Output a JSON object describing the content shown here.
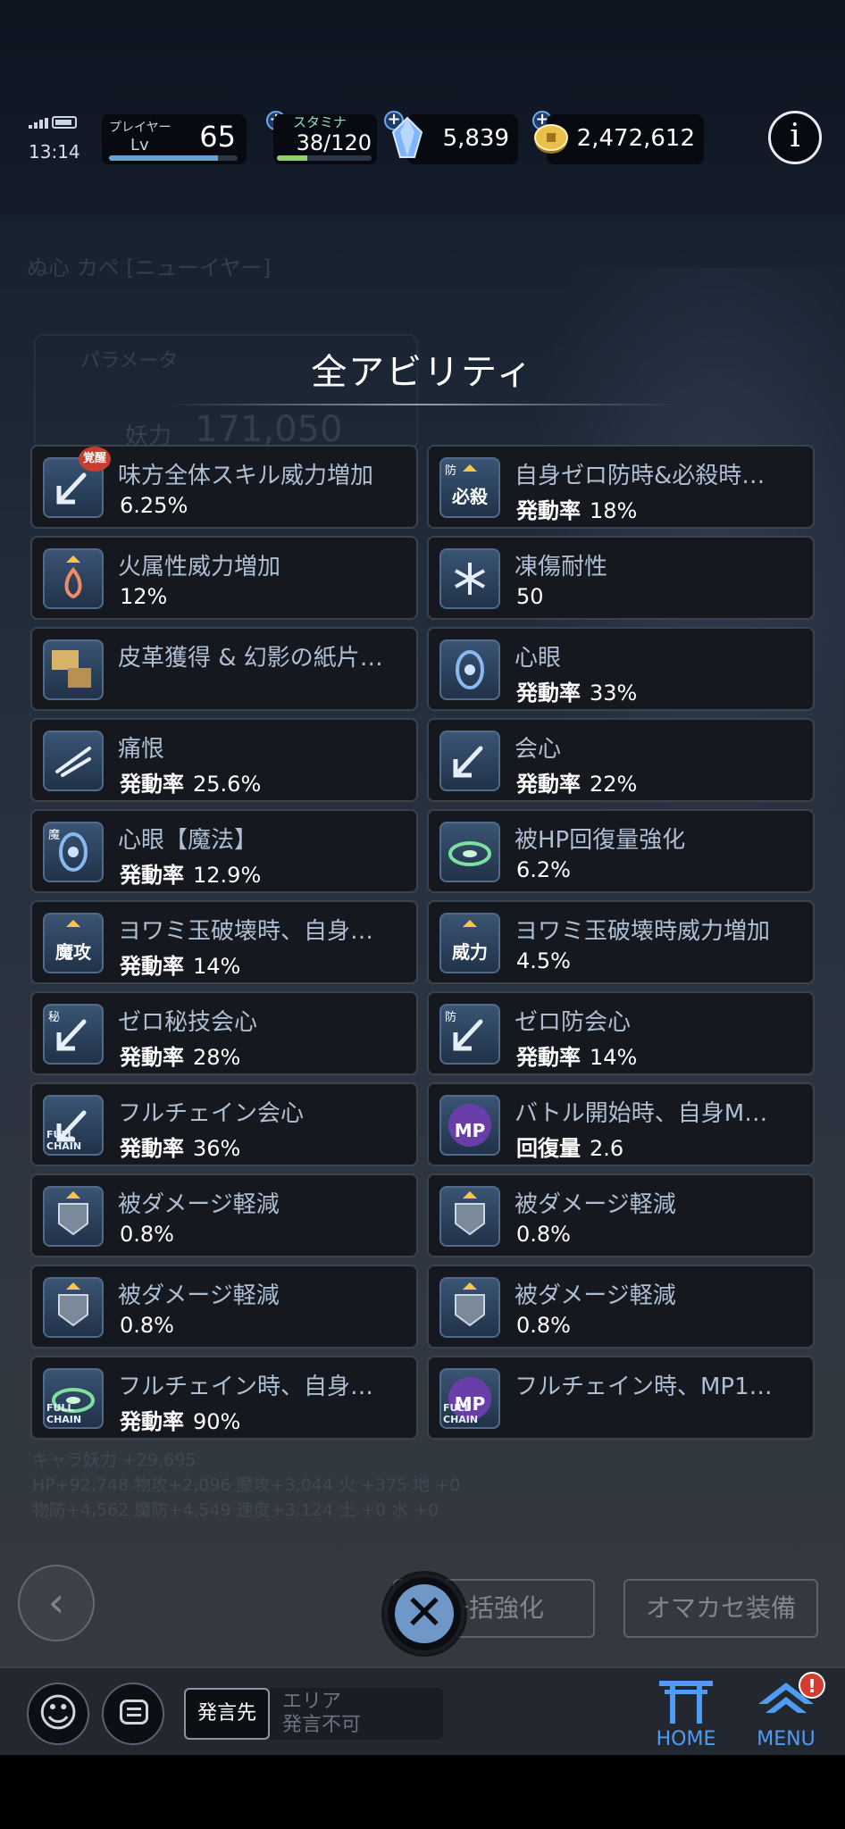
{
  "status_bar": {
    "time": "13:14"
  },
  "header": {
    "player_label": "プレイヤー",
    "lv_label": "Lv",
    "level": "65",
    "level_progress": 0.85,
    "stamina_label": "スタミナ",
    "stamina": "38/120",
    "stamina_progress": 0.32,
    "gems": "5,839",
    "coins": "2,472,612",
    "info_icon": "info-icon"
  },
  "background": {
    "character_name": "ぬ心 カペ [ニューイヤー]",
    "param_tab": "パラメータ",
    "stat_label": "妖力",
    "stat_value": "171,050",
    "sub_line1": "キャラ妖力 +29,695",
    "sub_line2": "HP+92,748 物攻+2,096 魔攻+3,044 火 +375 地 +0",
    "sub_line3": "物防+4,562 魔防+4,549 速度+3,124 土 +0 水 +0"
  },
  "panel": {
    "title": "全アビリティ",
    "abilities": [
      {
        "name": "味方全体スキル威力増加",
        "key": "",
        "value": "6.25%",
        "icon": "arrow-icon",
        "badge": "覚醒"
      },
      {
        "name": "自身ゼロ防時&必殺時…",
        "key": "発動率",
        "value": "18%",
        "icon": "hissatsu-icon",
        "icon_text": "必殺",
        "corner": "防"
      },
      {
        "name": "火属性威力増加",
        "key": "",
        "value": "12%",
        "icon": "fire-icon"
      },
      {
        "name": "凍傷耐性",
        "key": "",
        "value": "50",
        "icon": "snowflake-icon"
      },
      {
        "name": "皮革獲得 & 幻影の紙片…",
        "key": "",
        "value": "",
        "icon": "material-icon"
      },
      {
        "name": "心眼",
        "key": "発動率",
        "value": "33%",
        "icon": "eye-icon"
      },
      {
        "name": "痛恨",
        "key": "発動率",
        "value": "25.6%",
        "icon": "slash-icon"
      },
      {
        "name": "会心",
        "key": "発動率",
        "value": "22%",
        "icon": "arrow-icon"
      },
      {
        "name": "心眼【魔法】",
        "key": "発動率",
        "value": "12.9%",
        "icon": "eye-icon",
        "corner": "魔"
      },
      {
        "name": "被HP回復量強化",
        "key": "",
        "value": "6.2%",
        "icon": "heal-icon"
      },
      {
        "name": "ヨワミ玉破壊時、自身…",
        "key": "発動率",
        "value": "14%",
        "icon": "makou-icon",
        "icon_text": "魔攻"
      },
      {
        "name": "ヨワミ玉破壊時威力増加",
        "key": "",
        "value": "4.5%",
        "icon": "iryoku-icon",
        "icon_text": "威力"
      },
      {
        "name": "ゼロ秘技会心",
        "key": "発動率",
        "value": "28%",
        "icon": "arrow-icon",
        "corner": "秘"
      },
      {
        "name": "ゼロ防会心",
        "key": "発動率",
        "value": "14%",
        "icon": "arrow-icon",
        "corner": "防"
      },
      {
        "name": "フルチェイン会心",
        "key": "発動率",
        "value": "36%",
        "icon": "arrow-icon",
        "fc": "FULL CHAIN"
      },
      {
        "name": "バトル開始時、自身M…",
        "key": "回復量",
        "value": "2.6",
        "icon": "mp-icon",
        "icon_text": "MP"
      },
      {
        "name": "被ダメージ軽減",
        "key": "",
        "value": "0.8%",
        "icon": "shield-icon"
      },
      {
        "name": "被ダメージ軽減",
        "key": "",
        "value": "0.8%",
        "icon": "shield-icon"
      },
      {
        "name": "被ダメージ軽減",
        "key": "",
        "value": "0.8%",
        "icon": "shield-icon"
      },
      {
        "name": "被ダメージ軽減",
        "key": "",
        "value": "0.8%",
        "icon": "shield-icon"
      },
      {
        "name": "フルチェイン時、自身…",
        "key": "発動率",
        "value": "90%",
        "icon": "heal-icon",
        "fc": "FULL CHAIN"
      },
      {
        "name": "フルチェイン時、MP1…",
        "key": "",
        "value": "",
        "icon": "mp-icon",
        "icon_text": "MP",
        "fc": "FULL CHAIN"
      }
    ]
  },
  "actions": {
    "bulk_upgrade": "一括強化",
    "auto_equip": "オマカセ装備",
    "close_icon": "close-icon"
  },
  "chat": {
    "send_to": "発言先",
    "area_line1": "エリア",
    "area_line2": "発言不可"
  },
  "nav": {
    "home": "HOME",
    "menu": "MENU",
    "menu_badge": "!"
  },
  "colors": {
    "accent": "#4f9cf5",
    "panel_bg": "#15181e",
    "badge": "#d43c30"
  }
}
